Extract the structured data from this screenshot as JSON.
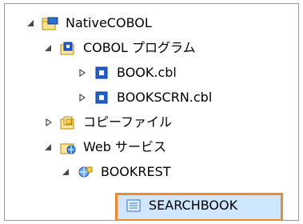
{
  "tree": {
    "items": [
      {
        "label": "NativeCOBOL",
        "icon": "project-icon",
        "expanded": true
      },
      {
        "label": "COBOL プログラム",
        "icon": "cobol-program-folder-icon",
        "expanded": true
      },
      {
        "label": "BOOK.cbl",
        "icon": "cobol-file-icon",
        "expanded": false
      },
      {
        "label": "BOOKSCRN.cbl",
        "icon": "cobol-file-icon",
        "expanded": false
      },
      {
        "label": "コピーファイル",
        "icon": "copyfile-folder-icon",
        "expanded": false
      },
      {
        "label": "Web サービス",
        "icon": "web-service-folder-icon",
        "expanded": true
      },
      {
        "label": "BOOKREST",
        "icon": "web-service-icon",
        "expanded": true
      },
      {
        "label": "SEARCHBOOK",
        "icon": "operation-icon",
        "expanded": false
      }
    ]
  },
  "colors": {
    "selection_border": "#f08a2e",
    "selection_fill": "#cfe6ff",
    "frame_border": "#9a9a9a"
  }
}
